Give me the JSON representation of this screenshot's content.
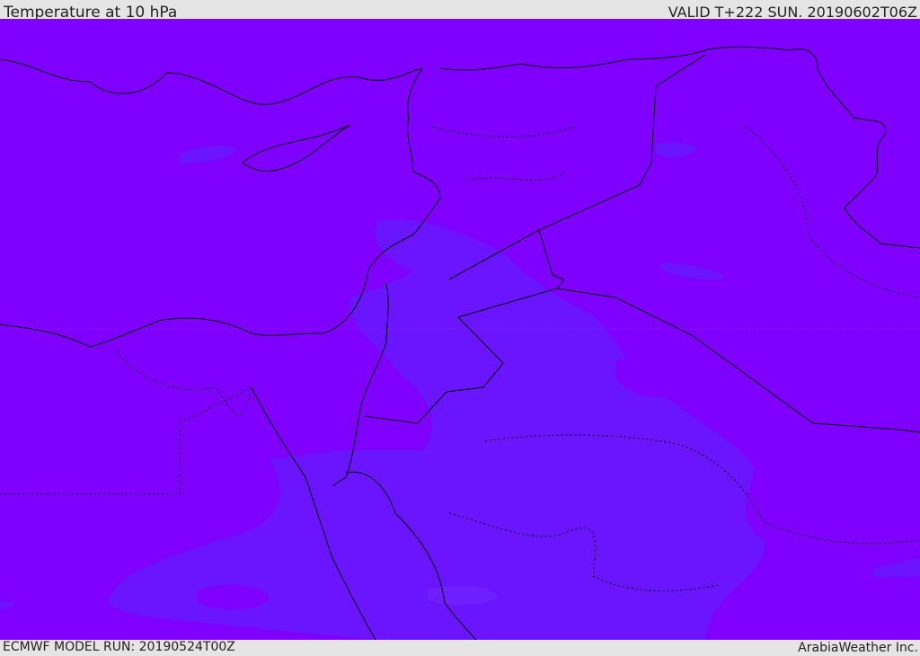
{
  "header": {
    "title": "Temperature at 10 hPa",
    "valid": "VALID T+222 SUN. 20190602T06Z"
  },
  "footer": {
    "model_run": "ECMWF MODEL RUN: 20190524T00Z",
    "credit": "ArabiaWeather Inc."
  },
  "colors": {
    "base_field": "#7f00ff",
    "cooler_field": "#6a14ff",
    "coast": "#000000"
  }
}
